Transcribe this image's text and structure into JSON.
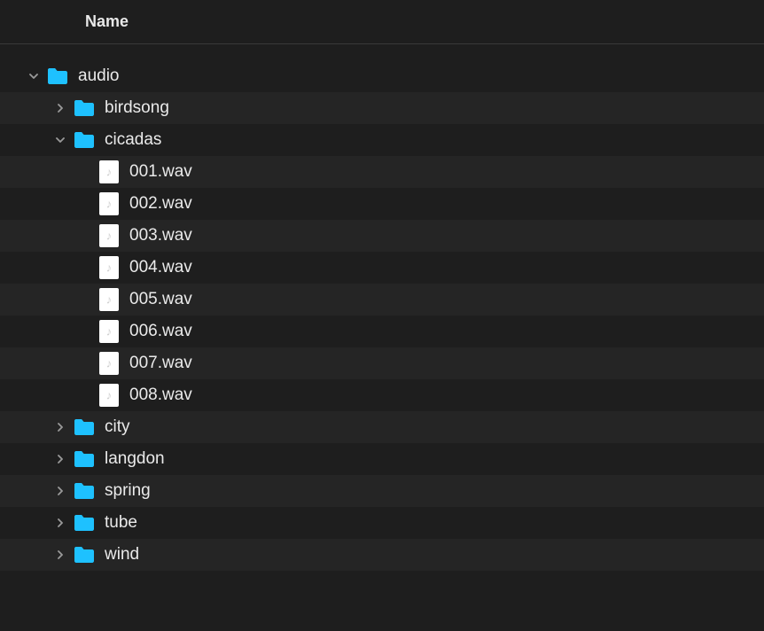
{
  "header": {
    "name_label": "Name"
  },
  "tree": {
    "rows": [
      {
        "depth": 0,
        "disclosure": "open",
        "icon": "folder",
        "label": "audio"
      },
      {
        "depth": 1,
        "disclosure": "closed",
        "icon": "folder",
        "label": "birdsong"
      },
      {
        "depth": 1,
        "disclosure": "open",
        "icon": "folder",
        "label": "cicadas"
      },
      {
        "depth": 2,
        "disclosure": "none",
        "icon": "audio",
        "label": "001.wav"
      },
      {
        "depth": 2,
        "disclosure": "none",
        "icon": "audio",
        "label": "002.wav"
      },
      {
        "depth": 2,
        "disclosure": "none",
        "icon": "audio",
        "label": "003.wav"
      },
      {
        "depth": 2,
        "disclosure": "none",
        "icon": "audio",
        "label": "004.wav"
      },
      {
        "depth": 2,
        "disclosure": "none",
        "icon": "audio",
        "label": "005.wav"
      },
      {
        "depth": 2,
        "disclosure": "none",
        "icon": "audio",
        "label": "006.wav"
      },
      {
        "depth": 2,
        "disclosure": "none",
        "icon": "audio",
        "label": "007.wav"
      },
      {
        "depth": 2,
        "disclosure": "none",
        "icon": "audio",
        "label": "008.wav"
      },
      {
        "depth": 1,
        "disclosure": "closed",
        "icon": "folder",
        "label": "city"
      },
      {
        "depth": 1,
        "disclosure": "closed",
        "icon": "folder",
        "label": "langdon"
      },
      {
        "depth": 1,
        "disclosure": "closed",
        "icon": "folder",
        "label": "spring"
      },
      {
        "depth": 1,
        "disclosure": "closed",
        "icon": "folder",
        "label": "tube"
      },
      {
        "depth": 1,
        "disclosure": "closed",
        "icon": "folder",
        "label": "wind"
      }
    ]
  },
  "colors": {
    "folder": "#1ec1ff"
  }
}
